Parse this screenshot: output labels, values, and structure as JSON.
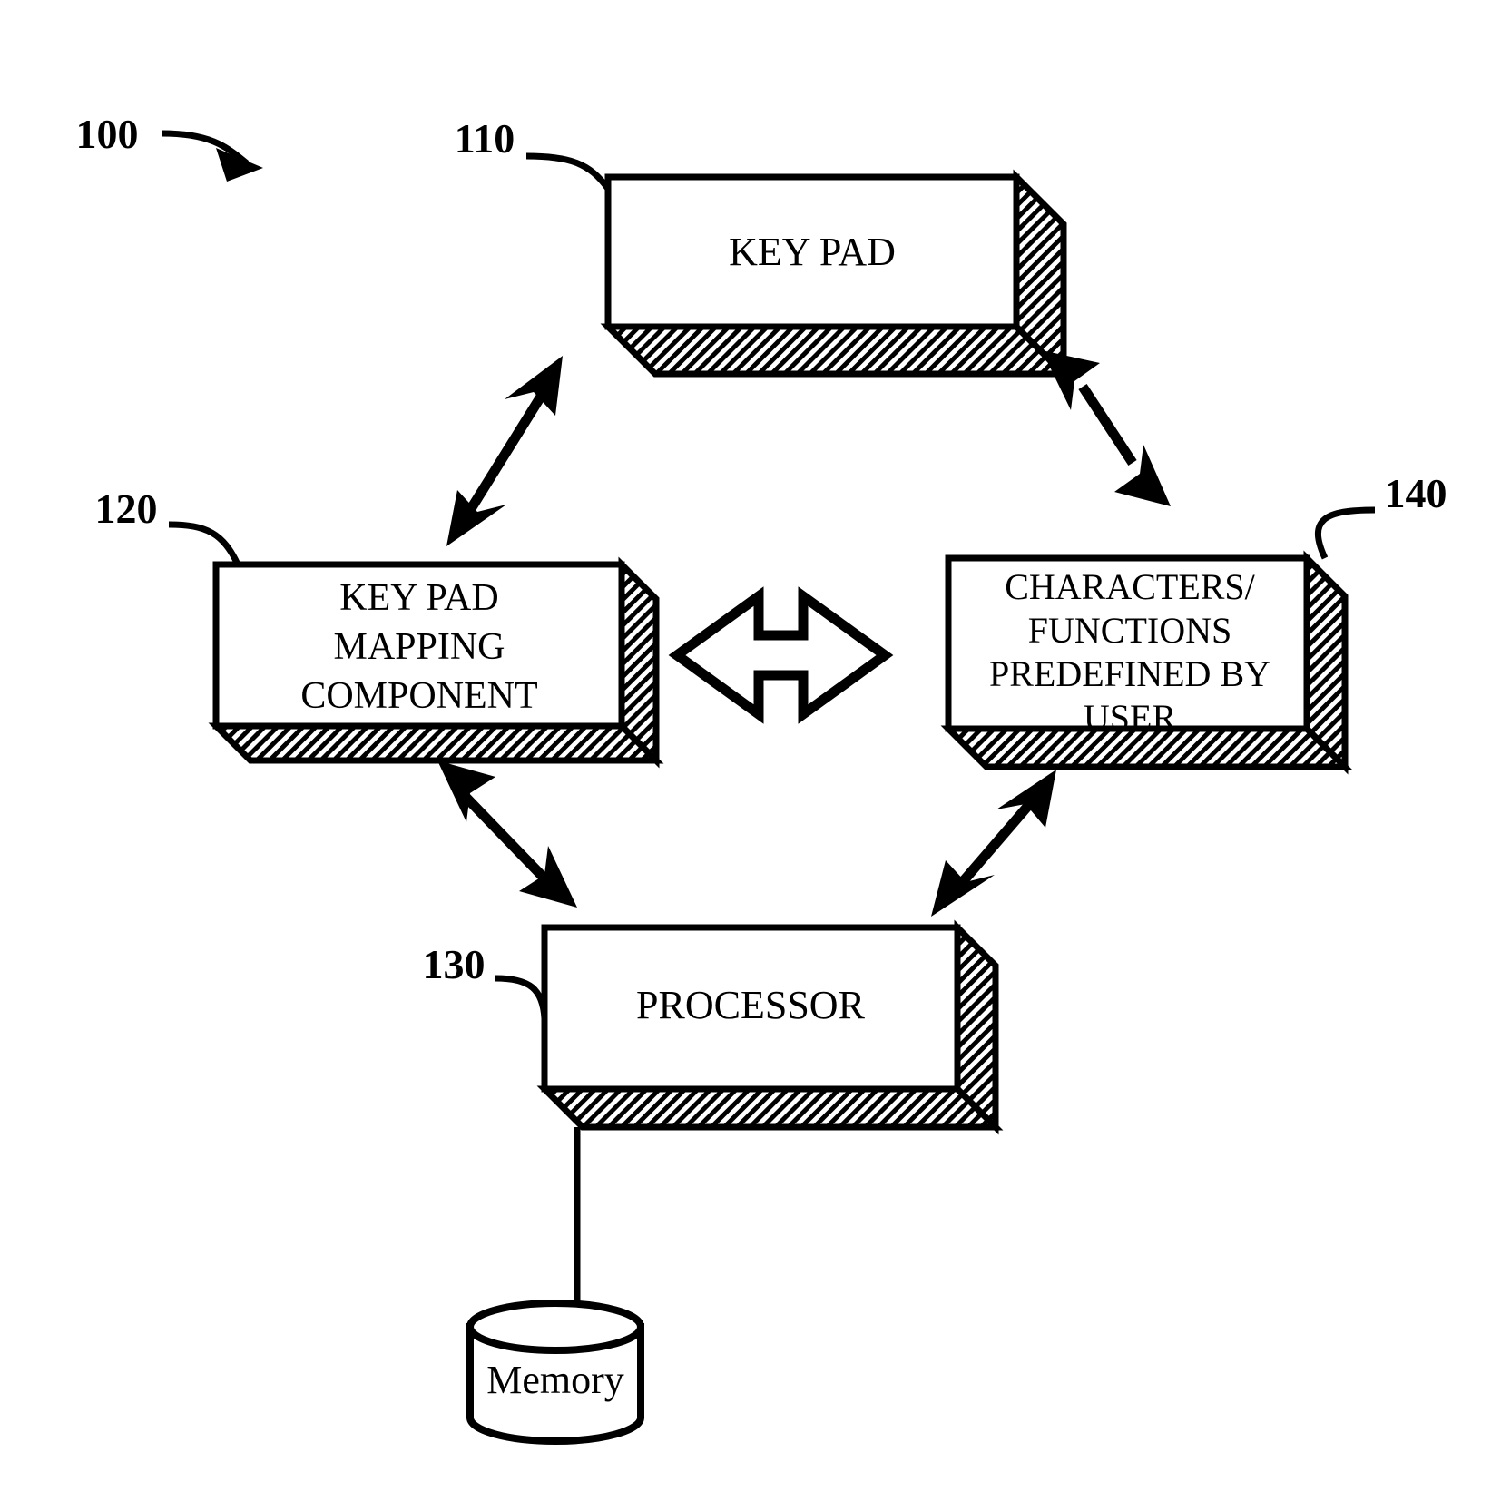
{
  "figure": {
    "kind": "patent-block-diagram",
    "system_ref": "100",
    "background_color": "#ffffff",
    "line_color": "#000000"
  },
  "nodes": {
    "keypad": {
      "ref": "110",
      "label_lines": [
        "KEY PAD"
      ],
      "shape": "3d-box"
    },
    "mapping": {
      "ref": "120",
      "label_lines": [
        "KEY PAD",
        "MAPPING",
        "COMPONENT"
      ],
      "shape": "3d-box"
    },
    "processor": {
      "ref": "130",
      "label_lines": [
        "PROCESSOR"
      ],
      "shape": "3d-box"
    },
    "predefined": {
      "ref": "140",
      "label_lines": [
        "CHARACTERS/",
        "FUNCTIONS",
        "PREDEFINED BY",
        "USER"
      ],
      "shape": "3d-box"
    },
    "memory": {
      "label_lines": [
        "Memory"
      ],
      "shape": "cylinder"
    }
  },
  "connectors": [
    {
      "id": "keypad-mapping",
      "from": "120",
      "to": "110",
      "style": "double-headed-solid-arrow"
    },
    {
      "id": "keypad-predefined",
      "from": "110",
      "to": "140",
      "style": "double-headed-solid-arrow"
    },
    {
      "id": "mapping-predefined",
      "from": "120",
      "to": "140",
      "style": "double-headed-hollow-block-arrow"
    },
    {
      "id": "mapping-processor",
      "from": "120",
      "to": "130",
      "style": "double-headed-solid-arrow"
    },
    {
      "id": "processor-predefined",
      "from": "130",
      "to": "140",
      "style": "double-headed-solid-arrow"
    },
    {
      "id": "processor-memory",
      "from": "130",
      "to": "memory",
      "style": "plain-line"
    }
  ],
  "icons": {
    "hatch_pattern": "diagonal-hatch-shading",
    "memory_icon": "database-cylinder-icon"
  }
}
